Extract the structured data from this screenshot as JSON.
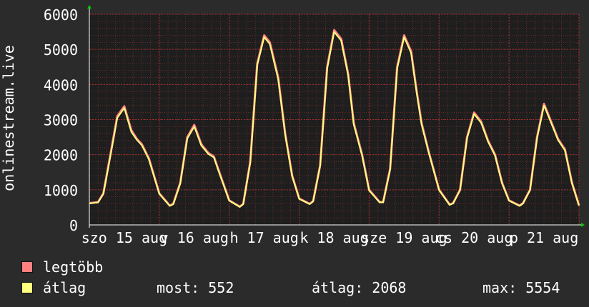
{
  "chart_data": {
    "type": "line",
    "ylabel": "onlinestream.live",
    "ylim": [
      0,
      6000
    ],
    "yticks": [
      0,
      1000,
      2000,
      3000,
      4000,
      5000,
      6000
    ],
    "x_tick_labels": [
      "szo 15 aug",
      "v 16 aug",
      "h 17 aug",
      "k 18 aug",
      "sze 19 aug",
      "cs 20 aug",
      "p 21 aug"
    ],
    "grid": true,
    "colors": {
      "background": "#2b2b2b",
      "plot_bg": "#1e1e1e",
      "grid": "#6a2a2a",
      "axis": "#ffffff",
      "max_series": "#ff8080",
      "avg_series": "#ffff80",
      "arrow": "#00cc00"
    },
    "x_days": [
      0,
      0.125,
      0.2,
      0.3,
      0.4,
      0.5,
      0.6,
      0.68,
      0.75,
      0.85,
      1.0,
      1.15,
      1.2,
      1.3,
      1.4,
      1.5,
      1.6,
      1.7,
      1.78,
      1.85,
      2.0,
      2.15,
      2.2,
      2.3,
      2.4,
      2.5,
      2.58,
      2.7,
      2.8,
      2.9,
      3.0,
      3.15,
      3.2,
      3.3,
      3.4,
      3.5,
      3.6,
      3.7,
      3.78,
      3.9,
      4.0,
      4.15,
      4.2,
      4.3,
      4.4,
      4.5,
      4.6,
      4.68,
      4.75,
      4.85,
      5.0,
      5.15,
      5.2,
      5.3,
      5.4,
      5.5,
      5.6,
      5.7,
      5.8,
      5.9,
      6.0,
      6.15,
      6.2,
      6.3,
      6.4,
      6.5,
      6.6,
      6.7,
      6.8,
      6.9,
      7.0
    ],
    "series": [
      {
        "name": "legtöbb",
        "values": [
          620,
          650,
          900,
          2000,
          3100,
          3380,
          2700,
          2450,
          2300,
          1900,
          900,
          550,
          600,
          1200,
          2500,
          2850,
          2300,
          2050,
          1950,
          1550,
          700,
          520,
          600,
          1800,
          4600,
          5400,
          5200,
          4200,
          2600,
          1400,
          750,
          600,
          680,
          1700,
          4500,
          5550,
          5300,
          4300,
          2900,
          2000,
          1000,
          650,
          650,
          1600,
          4500,
          5400,
          4950,
          3800,
          2900,
          2100,
          1000,
          580,
          620,
          1000,
          2500,
          3200,
          2950,
          2400,
          2000,
          1200,
          700,
          550,
          620,
          1000,
          2500,
          3450,
          2950,
          2450,
          2150,
          1200,
          560
        ]
      },
      {
        "name": "átlag",
        "values": [
          610,
          640,
          880,
          1950,
          3050,
          3330,
          2650,
          2420,
          2270,
          1870,
          880,
          540,
          590,
          1180,
          2460,
          2800,
          2260,
          2020,
          1920,
          1520,
          690,
          510,
          590,
          1770,
          4550,
          5350,
          5150,
          4150,
          2560,
          1380,
          740,
          590,
          670,
          1680,
          4450,
          5500,
          5250,
          4250,
          2860,
          1970,
          980,
          640,
          640,
          1580,
          4450,
          5350,
          4900,
          3750,
          2860,
          2070,
          990,
          570,
          610,
          990,
          2470,
          3160,
          2910,
          2370,
          1970,
          1180,
          690,
          540,
          610,
          990,
          2470,
          3400,
          2910,
          2420,
          2120,
          1180,
          552
        ]
      }
    ]
  },
  "legend": {
    "max_label": "legtöbb",
    "avg_label": "átlag",
    "now": "most: 552",
    "avg": "átlag: 2068",
    "max": "max: 5554"
  }
}
